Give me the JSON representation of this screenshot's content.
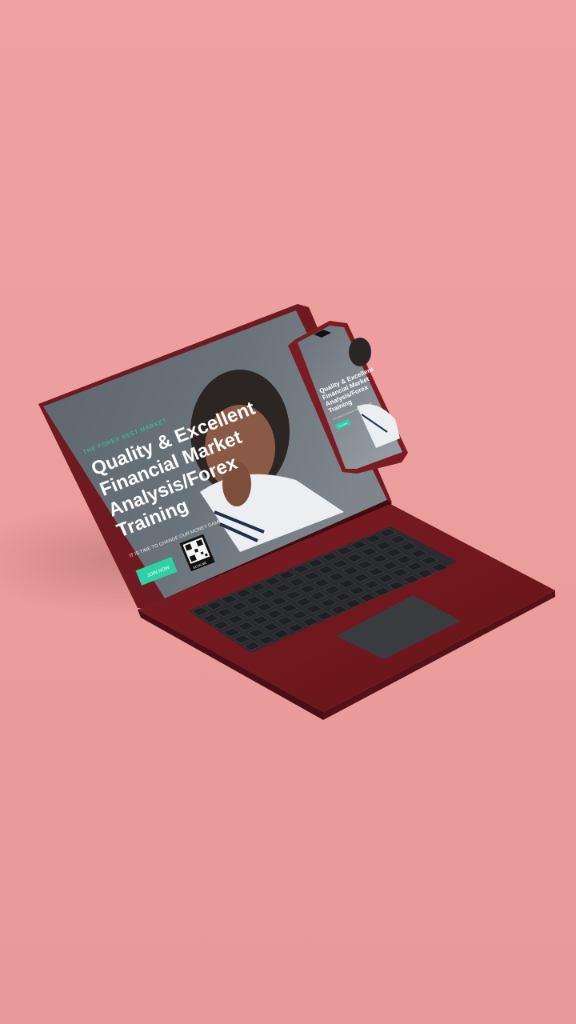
{
  "colors": {
    "background": "#ec9e9d",
    "laptop_body": "#7a1c22",
    "laptop_deck": "#6e1a20",
    "screen_bg": "#5f676f",
    "accent": "#2fd0a8",
    "headline": "#ffffff",
    "keyboard": "#2a2b2e"
  },
  "laptop_screen": {
    "eyebrow": "THE FOREX BEST MARKET",
    "headline_lines": [
      "Quality & Excellent",
      "Financial Market",
      "Analysis/Forex",
      "Training"
    ],
    "subtext": "IT IS TIME TO CHANGE OUR MONEY GAME",
    "cta_label": "JOIN NOW",
    "qr_label": "SCAN ME"
  },
  "phone_screen": {
    "headline_lines": [
      "Quality & Excellent",
      "Financial Market",
      "Analysis/Forex",
      "Training"
    ],
    "subtext": "IT IS TIME TO CHANGE OUR MONEY GAME",
    "cta_label": "JOIN NOW"
  }
}
